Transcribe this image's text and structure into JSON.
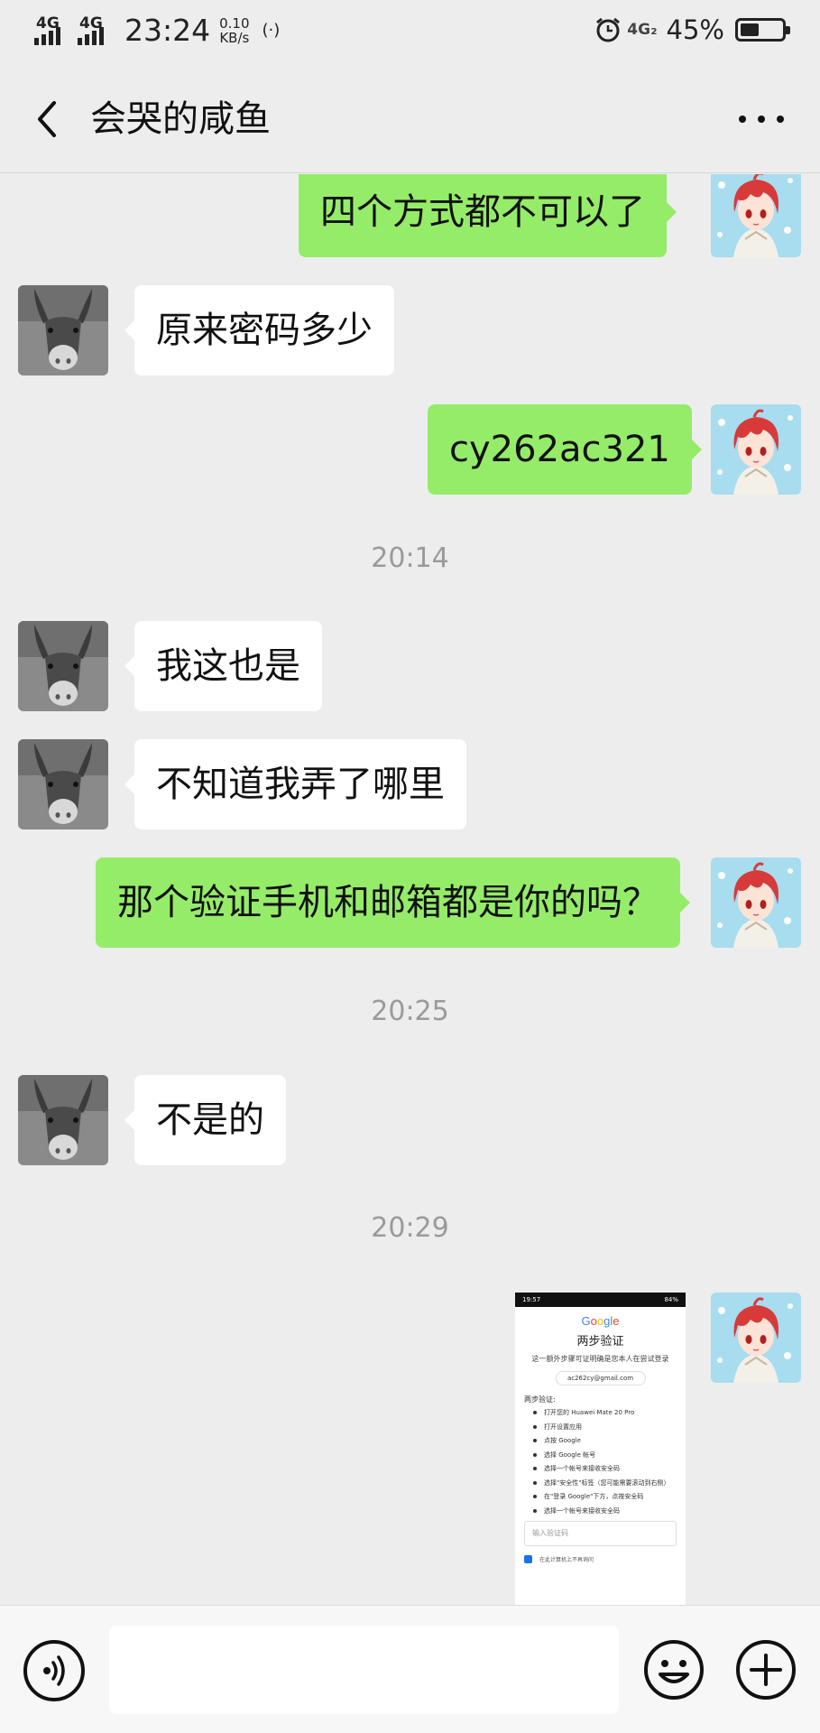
{
  "status_bar": {
    "network_1": "4G",
    "network_2": "4G",
    "time": "23:24",
    "speed_value": "0.10",
    "speed_unit": "KB/s",
    "network_3": "4G₂",
    "battery_percent": "45%",
    "battery_level": 0.45
  },
  "header": {
    "title": "会哭的咸鱼"
  },
  "messages": [
    {
      "sender": "me",
      "text": "四个方式都不可以了"
    },
    {
      "sender": "other",
      "text": "原来密码多少"
    },
    {
      "sender": "me",
      "text": "cy262ac321"
    },
    {
      "type": "timestamp",
      "text": "20:14"
    },
    {
      "sender": "other",
      "text": "我这也是"
    },
    {
      "sender": "other",
      "text": "不知道我弄了哪里"
    },
    {
      "sender": "me",
      "text": "那个验证手机和邮箱都是你的吗？"
    },
    {
      "type": "timestamp",
      "text": "20:25"
    },
    {
      "sender": "other",
      "text": "不是的"
    },
    {
      "type": "timestamp",
      "text": "20:29"
    },
    {
      "sender": "me",
      "type": "image"
    }
  ],
  "screenshot_image": {
    "status_time": "19:57",
    "status_battery": "84%",
    "logo_letters": [
      "G",
      "o",
      "o",
      "g",
      "l",
      "e"
    ],
    "heading": "两步验证",
    "description": "这一额外步骤可证明确是您本人在尝试登录",
    "account": "ac262cy@gmail.com",
    "steps_intro": "两步验证:",
    "steps": [
      "打开您的 Huawei Mate 20 Pro",
      "打开设置应用",
      "点按 Google",
      "选择 Google 帐号",
      "选择一个帐号来接收安全码",
      "选择\"安全性\"标签（您可能需要滚动到右侧）",
      "在\"登录 Google\"下方，点按安全码",
      "选择一个帐号来接收安全码"
    ],
    "code_placeholder": "输入验证码",
    "remember_label": "在此计算机上不再询问"
  },
  "input_bar": {
    "message_value": ""
  },
  "icons": {
    "back": "chevron-left-icon",
    "more": "more-dots-icon",
    "voice": "voice-icon",
    "emoji": "emoji-icon",
    "plus": "plus-icon"
  },
  "colors": {
    "background": "#ededed",
    "outgoing_bubble": "#95ec69",
    "incoming_bubble": "#ffffff",
    "timestamp": "#9a9a9a"
  }
}
